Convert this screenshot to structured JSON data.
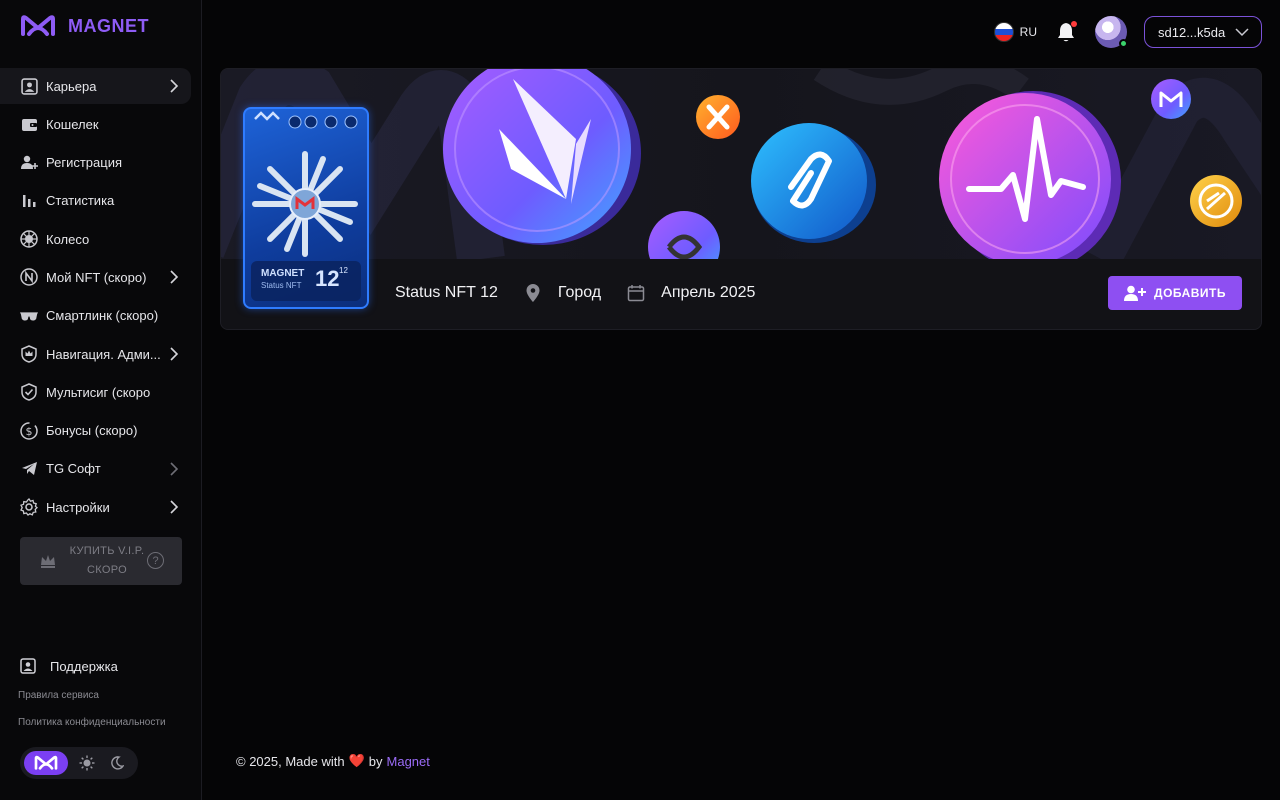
{
  "app": {
    "brand": "MAGNET"
  },
  "header": {
    "language": "RU",
    "wallet": "sd12...k5da",
    "notification_icon": "bell-icon",
    "has_notifications": true
  },
  "sidebar": {
    "items": [
      {
        "label": "Карьера",
        "icon": "user-card-icon",
        "active": true,
        "chevron": true
      },
      {
        "label": "Кошелек",
        "icon": "wallet-icon",
        "active": false,
        "chevron": false
      },
      {
        "label": "Регистрация",
        "icon": "user-add-icon",
        "active": false,
        "chevron": false
      },
      {
        "label": "Статистика",
        "icon": "bar-chart-icon",
        "active": false,
        "chevron": false
      },
      {
        "label": "Колесо",
        "icon": "wheel-icon",
        "active": false,
        "chevron": false
      },
      {
        "label": "Мой NFT (скоро)",
        "icon": "nft-icon",
        "active": false,
        "chevron": true
      },
      {
        "label": "Смартлинк (скоро)",
        "icon": "glasses-icon",
        "active": false,
        "chevron": false
      },
      {
        "label": "Навигация. Адми...",
        "icon": "crown-shield-icon",
        "active": false,
        "chevron": true
      },
      {
        "label": "Мультисиг (скоро",
        "icon": "shield-check-icon",
        "active": false,
        "chevron": false
      },
      {
        "label": "Бонусы (скоро)",
        "icon": "dollar-coin-icon",
        "active": false,
        "chevron": false
      },
      {
        "label": "TG Софт",
        "icon": "telegram-icon",
        "active": false,
        "chevron": true
      },
      {
        "label": "Настройки",
        "icon": "gear-icon",
        "active": false,
        "chevron": true
      }
    ],
    "vip_button": {
      "line1": "КУПИТЬ V.I.P.",
      "line2": "СКОРО"
    },
    "support": "Поддержка",
    "links": [
      "Правила сервиса",
      "Политика конфиденциальности"
    ]
  },
  "profile": {
    "nft_card": {
      "brand": "MAGNET",
      "subtitle": "Status NFT",
      "level": "12",
      "level_sup": "12"
    },
    "status": "Status NFT 12",
    "city": "Город",
    "date": "Апрель 2025",
    "add_button": "ДОБАВИТЬ"
  },
  "footer": {
    "prefix": "© 2025, Made with",
    "heart": "❤️",
    "by": "by",
    "link": "Magnet"
  },
  "colors": {
    "accent": "#8e4ff2",
    "brand": "#8e5cf5",
    "background": "#050506"
  }
}
